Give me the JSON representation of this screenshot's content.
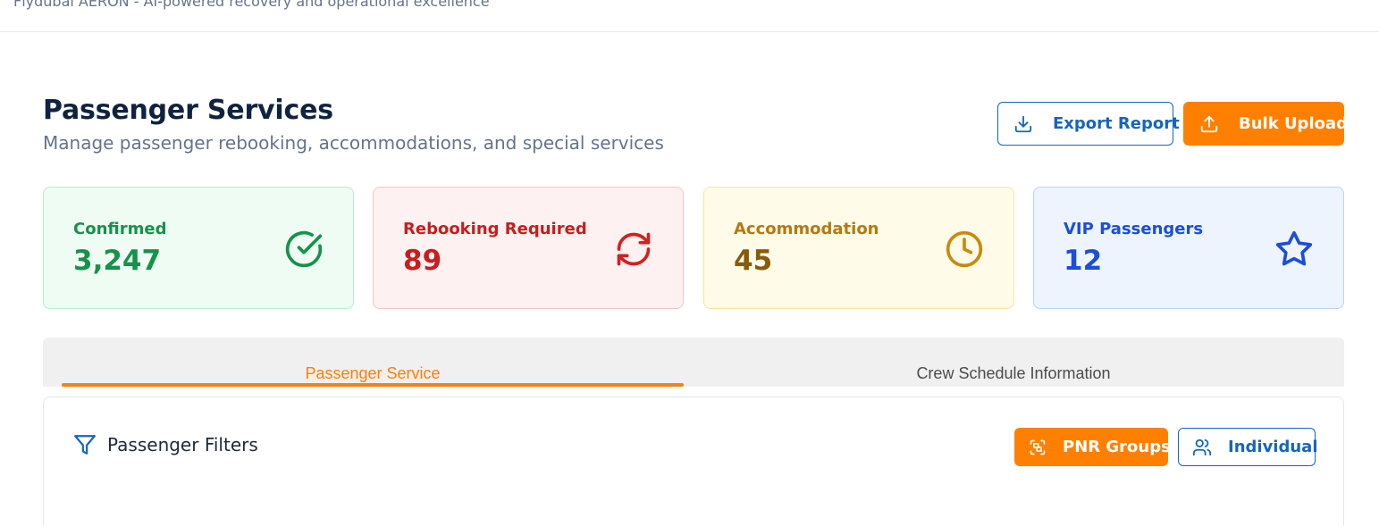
{
  "topbar": {
    "tagline": "Flydubai AERON - AI-powered recovery and operational excellence"
  },
  "header": {
    "title": "Passenger Services",
    "subtitle": "Manage passenger rebooking, accommodations, and special services",
    "export_label": "Export Report",
    "upload_label": "Bulk Upload",
    "export_icon": "download-icon",
    "upload_icon": "upload-icon"
  },
  "stats": [
    {
      "label": "Confirmed",
      "value": "3,247",
      "icon": "check-circle-icon",
      "color": "#16924b"
    },
    {
      "label": "Rebooking Required",
      "value": "89",
      "icon": "refresh-icon",
      "color": "#c81e1e"
    },
    {
      "label": "Accommodation",
      "value": "45",
      "icon": "clock-icon",
      "color": "#b7790c"
    },
    {
      "label": "VIP Passengers",
      "value": "12",
      "icon": "star-icon",
      "color": "#1d4ed8"
    }
  ],
  "tabs": [
    {
      "label": "Passenger Service",
      "active": true
    },
    {
      "label": "Crew Schedule Information",
      "active": false
    }
  ],
  "filters": {
    "title": "Passenger Filters",
    "icon": "filter-icon",
    "pnr_groups_label": "PNR Groups",
    "individual_label": "Individual"
  },
  "colors": {
    "accent_orange": "#ff8000",
    "primary_blue": "#1565c0"
  }
}
